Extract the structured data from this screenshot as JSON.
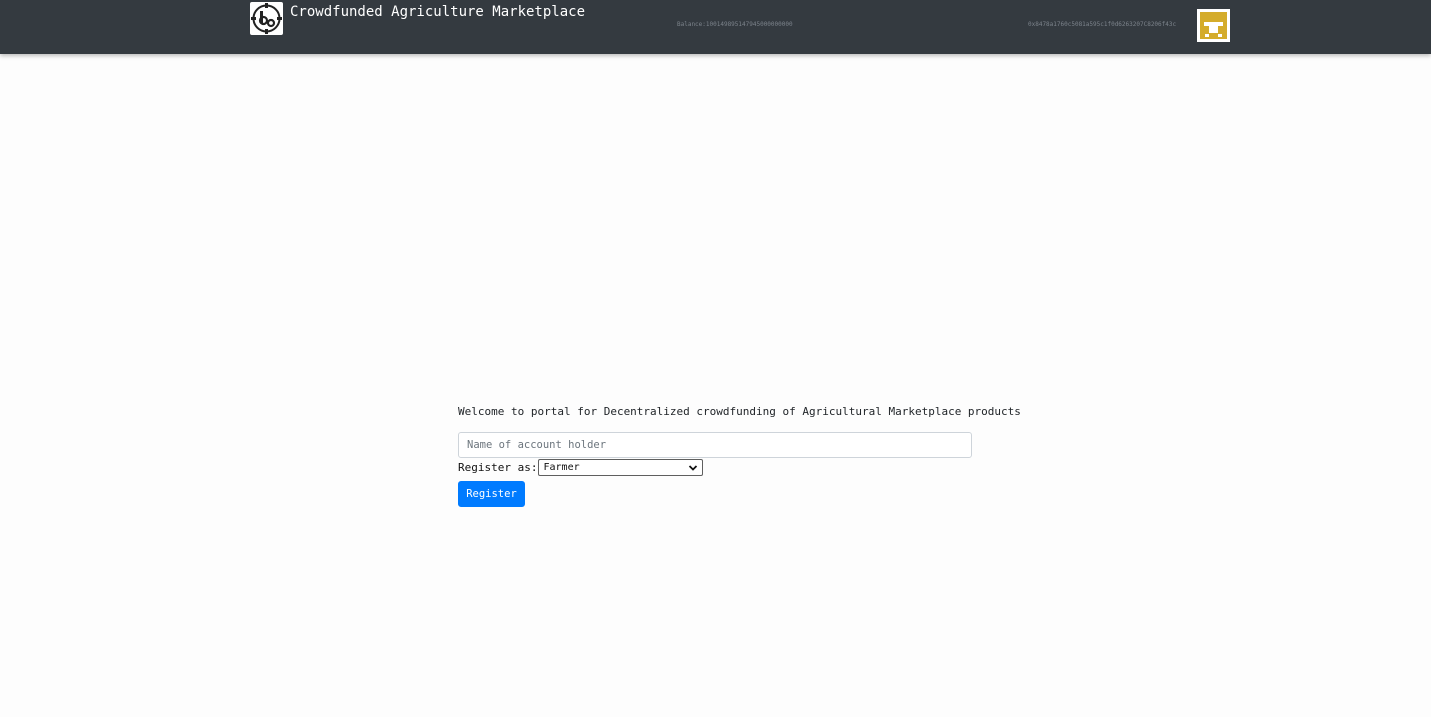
{
  "navbar": {
    "logo_icon": "tractor-badge-logo-icon",
    "brand_title": "Crowdfunded Agriculture Marketplace",
    "balance_text": "Balance:100149895147945000000000",
    "account_address": "0x8478a1760c5081a595c1f0d6263207C8206f43c",
    "avatar_icon": "yellow-identicon-icon",
    "avatar_color": "#d4ac2b"
  },
  "main": {
    "welcome_text": "Welcome to portal for Decentralized crowdfunding of Agricultural Marketplace products",
    "name_input": {
      "placeholder": "Name of account holder",
      "value": ""
    },
    "register_as_label": "Register as:",
    "role_select": {
      "selected": "Farmer"
    },
    "register_button_label": "Register",
    "accent_color": "#007bff"
  }
}
